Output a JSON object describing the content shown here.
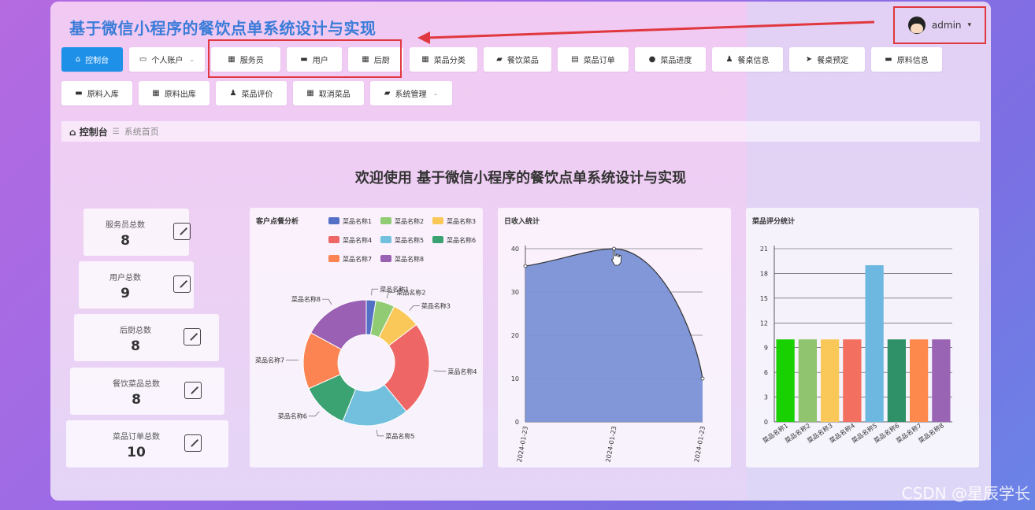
{
  "app": {
    "title": "基于微信小程序的餐饮点单系统设计与实现"
  },
  "user": {
    "name": "admin",
    "caret": "▾"
  },
  "nav_row1": [
    {
      "label": "控制台",
      "icon": "⌂",
      "active": true
    },
    {
      "label": "个人账户",
      "icon": "▭",
      "dropdown": true
    },
    {
      "label": "服务员",
      "icon": "▦"
    },
    {
      "label": "用户",
      "icon": "▬"
    },
    {
      "label": "后厨",
      "icon": "▦"
    },
    {
      "label": "菜品分类",
      "icon": "▦"
    },
    {
      "label": "餐饮菜品",
      "icon": "▰"
    },
    {
      "label": "菜品订单",
      "icon": "▤"
    },
    {
      "label": "菜品进度",
      "icon": "●"
    },
    {
      "label": "餐桌信息",
      "icon": "♟"
    },
    {
      "label": "餐桌预定",
      "icon": "➤"
    },
    {
      "label": "原料信息",
      "icon": "▬"
    }
  ],
  "nav_row2": [
    {
      "label": "原料入库",
      "icon": "▬"
    },
    {
      "label": "原料出库",
      "icon": "▦"
    },
    {
      "label": "菜品评价",
      "icon": "♟"
    },
    {
      "label": "取消菜品",
      "icon": "▦"
    },
    {
      "label": "系统管理",
      "icon": "▰",
      "dropdown": true
    }
  ],
  "breadcrumb": {
    "home": "控制台",
    "sep": "☰",
    "current": "系统首页"
  },
  "welcome": "欢迎使用 基于微信小程序的餐饮点单系统设计与实现",
  "stats": [
    {
      "label": "服务员总数",
      "value": "8"
    },
    {
      "label": "用户总数",
      "value": "9"
    },
    {
      "label": "后厨总数",
      "value": "8"
    },
    {
      "label": "餐饮菜品总数",
      "value": "8"
    },
    {
      "label": "菜品订单总数",
      "value": "10"
    }
  ],
  "panels": {
    "pie_title": "客户点餐分析",
    "line_title": "日收入统计",
    "bar_title": "菜品评分统计"
  },
  "chart_data": [
    {
      "type": "pie",
      "title": "客户点餐分析",
      "legend": "top-right",
      "categories": [
        "菜品名称1",
        "菜品名称2",
        "菜品名称3",
        "菜品名称4",
        "菜品名称5",
        "菜品名称6",
        "菜品名称7",
        "菜品名称8"
      ],
      "values": [
        1,
        2,
        3,
        10,
        7,
        5,
        6,
        7
      ],
      "colors": [
        "#5470c6",
        "#91cc75",
        "#fac858",
        "#ee6666",
        "#73c0de",
        "#3ba272",
        "#fc8452",
        "#9a60b4"
      ]
    },
    {
      "type": "area",
      "title": "日收入统计",
      "x": [
        "2024-01-23",
        "2024-01-23",
        "2024-01-23"
      ],
      "values": [
        36,
        40,
        10
      ],
      "ylim": [
        0,
        40
      ],
      "yticks": [
        0,
        10,
        20,
        30,
        40
      ],
      "grid": true,
      "color": "#7a91d6"
    },
    {
      "type": "bar",
      "title": "菜品评分统计",
      "categories": [
        "菜品名称1",
        "菜品名称2",
        "菜品名称3",
        "菜品名称4",
        "菜品名称5",
        "菜品名称6",
        "菜品名称7",
        "菜品名称8"
      ],
      "values": [
        10,
        10,
        10,
        10,
        19,
        10,
        10,
        10
      ],
      "ylim": [
        0,
        21
      ],
      "yticks": [
        0,
        3,
        6,
        9,
        12,
        15,
        18,
        21
      ],
      "grid": true,
      "colors": [
        "#19d000",
        "#91c46e",
        "#fac858",
        "#f36f60",
        "#6db8e0",
        "#2f9168",
        "#fd8a4c",
        "#9a64b4"
      ]
    }
  ],
  "watermark": "CSDN @星辰学长"
}
